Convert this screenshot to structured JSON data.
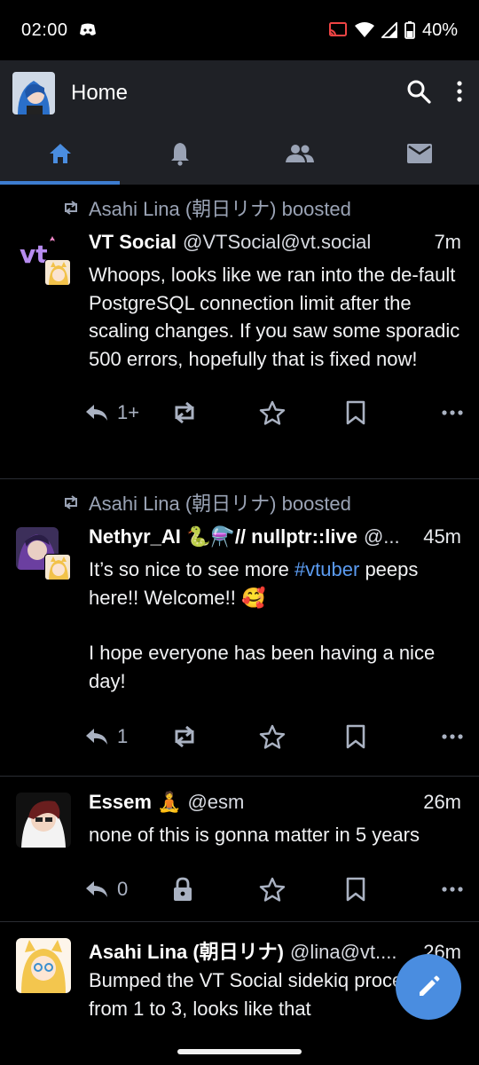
{
  "status_bar": {
    "time": "02:00",
    "battery": "40%",
    "icons": [
      "discord-icon",
      "cast-icon",
      "wifi-icon",
      "signal-icon",
      "battery-icon"
    ]
  },
  "app_bar": {
    "title": "Home",
    "icons": [
      "search-icon",
      "more-vert-icon"
    ]
  },
  "tabs": [
    {
      "icon": "home-icon",
      "active": true
    },
    {
      "icon": "bell-icon",
      "active": false
    },
    {
      "icon": "people-icon",
      "active": false
    },
    {
      "icon": "mail-icon",
      "active": false
    }
  ],
  "posts": [
    {
      "boosted_by": "Asahi Lina (朝日リナ) boosted",
      "display_name": "VT Social",
      "handle": "@VTSocial@vt.social",
      "time": "7m",
      "content": [
        "Whoops, looks like we ran into the de-fault PostgreSQL connection limit after the scaling changes. If you saw some sporadic 500 errors, hopefully that is fixed now!"
      ],
      "reply_count": "1+",
      "boost_icon": "boost-icon"
    },
    {
      "boosted_by": "Asahi Lina (朝日リナ) boosted",
      "display_name": "Nethyr_AI 🐍⚗️// nullptr::live",
      "handle": "@...",
      "time": "45m",
      "content_line1_pre": "It’s so nice to see more ",
      "content_hashtag": "#vtuber",
      "content_line1_post": " peeps here!! Welcome!! 🥰",
      "content_para2": "I hope everyone has been having a nice day!",
      "reply_count": "1",
      "boost_icon": "boost-icon"
    },
    {
      "display_name": "Essem 🧘",
      "handle": "@esm",
      "time": "26m",
      "content": [
        "none of this is gonna matter in 5 years"
      ],
      "reply_count": "0",
      "boost_icon": "lock-icon"
    },
    {
      "display_name": "Asahi Lina (朝日リナ)",
      "handle": "@lina@vt....",
      "time": "26m",
      "content": [
        "Bumped the VT Social sidekiq processes from 1 to 3, looks like that"
      ]
    }
  ],
  "fab": {
    "icon": "edit-pencil-icon"
  },
  "colors": {
    "background": "#000000",
    "app_bar": "#1f2126",
    "accent": "#3d7dd0",
    "fab": "#4a8de0",
    "muted": "#9aa3b5",
    "hashtag": "#5b9bf0"
  }
}
